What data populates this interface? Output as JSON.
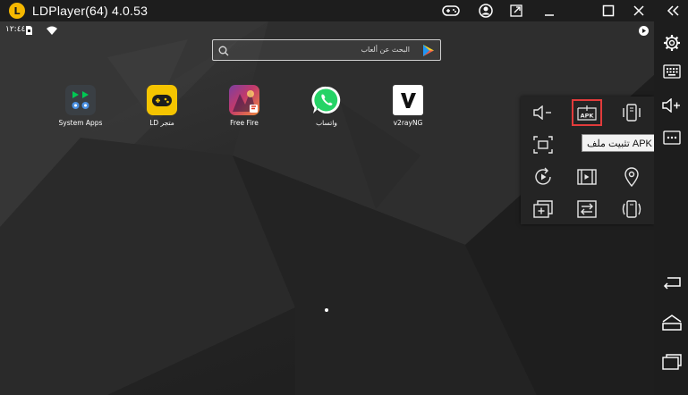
{
  "window": {
    "title": "LDPlayer(64) 4.0.53",
    "logo_letter": "L"
  },
  "titlebar_buttons": [
    "gamepad-icon",
    "user-icon",
    "external-link-icon",
    "minimize-icon",
    "maximize-icon",
    "close-icon",
    "collapse-double-chevron-icon"
  ],
  "status_bar": {
    "time": "١٢:٤٤",
    "icons": [
      "sim-card-icon",
      "wifi-icon",
      "ld-notification-icon"
    ]
  },
  "search": {
    "placeholder": "البحث عن ألعاب",
    "icons": [
      "search-icon",
      "play-store-icon"
    ]
  },
  "apps": [
    {
      "label": "System Apps",
      "icon": "system-apps-icon"
    },
    {
      "label": "LD متجر",
      "icon": "ld-store-icon"
    },
    {
      "label": "Free Fire",
      "icon": "free-fire-icon"
    },
    {
      "label": "واتساب",
      "icon": "whatsapp-icon"
    },
    {
      "label": "v2rayNG",
      "icon": "v2rayng-icon"
    }
  ],
  "panel": {
    "items": [
      {
        "name": "volume-down-icon"
      },
      {
        "name": "install-apk-icon",
        "text": "APK",
        "highlight": true
      },
      {
        "name": "shake-icon"
      },
      {
        "name": "screenshot-icon"
      },
      {
        "name": "hidden-icon"
      },
      {
        "name": "hidden-icon-2"
      },
      {
        "name": "rotate-icon"
      },
      {
        "name": "video-record-icon"
      },
      {
        "name": "location-icon"
      },
      {
        "name": "add-multi-instance-icon"
      },
      {
        "name": "sync-icon"
      },
      {
        "name": "vibrate-icon"
      }
    ]
  },
  "tooltip": {
    "text": "تثبيت ملف APK (ctrl +"
  },
  "right_sidebar": [
    "settings-gear-icon",
    "keyboard-icon",
    "volume-up-icon",
    "more-icon",
    "back-icon",
    "home-icon",
    "recents-icon"
  ],
  "colors": {
    "highlight": "#e23b3b",
    "accent": "#f5b800",
    "whatsapp": "#25d366",
    "play_green": "#00c853"
  }
}
